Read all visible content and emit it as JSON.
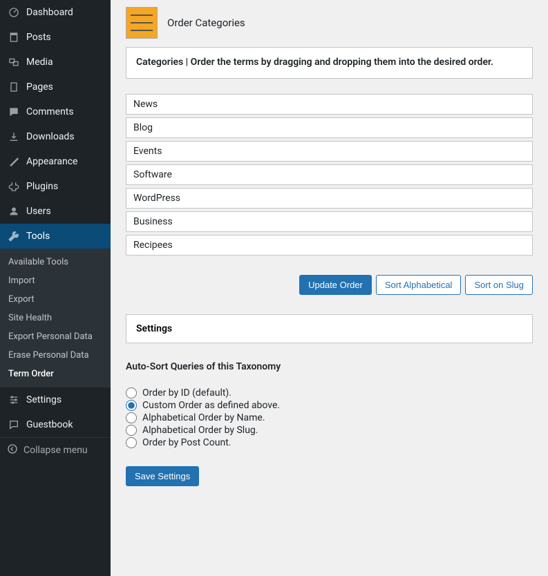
{
  "sidebar": {
    "items": [
      {
        "label": "Dashboard",
        "icon": "dashboard-icon"
      },
      {
        "label": "Posts",
        "icon": "posts-icon"
      },
      {
        "label": "Media",
        "icon": "media-icon"
      },
      {
        "label": "Pages",
        "icon": "pages-icon"
      },
      {
        "label": "Comments",
        "icon": "comments-icon"
      },
      {
        "label": "Downloads",
        "icon": "downloads-icon"
      },
      {
        "label": "Appearance",
        "icon": "appearance-icon"
      },
      {
        "label": "Plugins",
        "icon": "plugins-icon"
      },
      {
        "label": "Users",
        "icon": "users-icon"
      },
      {
        "label": "Tools",
        "icon": "tools-icon",
        "active": true
      }
    ],
    "tools_sub": [
      "Available Tools",
      "Import",
      "Export",
      "Site Health",
      "Export Personal Data",
      "Erase Personal Data",
      "Term Order"
    ],
    "after_sub": [
      {
        "label": "Settings",
        "icon": "settings-icon"
      },
      {
        "label": "Guestbook",
        "icon": "guestbook-icon"
      }
    ],
    "collapse_label": "Collapse menu"
  },
  "header": {
    "page_title": "Order Categories"
  },
  "instruction": "Categories | Order the terms by dragging and dropping them into the desired order.",
  "categories": [
    "News",
    "Blog",
    "Events",
    "Software",
    "WordPress",
    "Business",
    "Recipees"
  ],
  "buttons": {
    "update_order": "Update Order",
    "sort_alpha": "Sort Alphabetical",
    "sort_slug": "Sort on Slug",
    "save_settings": "Save Settings"
  },
  "settings": {
    "heading": "Settings",
    "subheading": "Auto-Sort Queries of this Taxonomy",
    "options": [
      {
        "label": "Order by ID (default).",
        "checked": false
      },
      {
        "label": "Custom Order as defined above.",
        "checked": true
      },
      {
        "label": "Alphabetical Order by Name.",
        "checked": false
      },
      {
        "label": "Alphabetical Order by Slug.",
        "checked": false
      },
      {
        "label": "Order by Post Count.",
        "checked": false
      }
    ]
  }
}
